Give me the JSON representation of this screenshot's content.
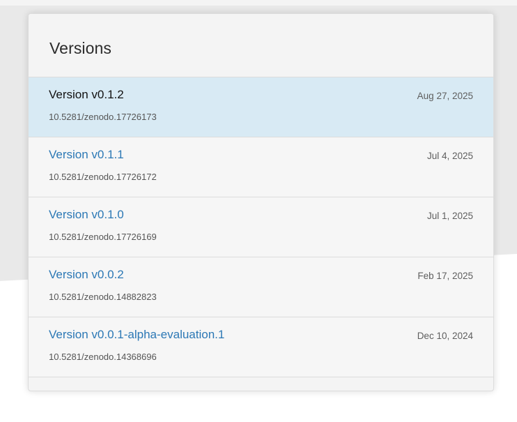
{
  "panel": {
    "title": "Versions"
  },
  "versions": [
    {
      "name": "Version v0.1.2",
      "doi": "10.5281/zenodo.17726173",
      "date": "Aug 27, 2025",
      "selected": true
    },
    {
      "name": "Version v0.1.1",
      "doi": "10.5281/zenodo.17726172",
      "date": "Jul 4, 2025",
      "selected": false
    },
    {
      "name": "Version v0.1.0",
      "doi": "10.5281/zenodo.17726169",
      "date": "Jul 1, 2025",
      "selected": false
    },
    {
      "name": "Version v0.0.2",
      "doi": "10.5281/zenodo.14882823",
      "date": "Feb 17, 2025",
      "selected": false
    },
    {
      "name": "Version v0.0.1-alpha-evaluation.1",
      "doi": "10.5281/zenodo.14368696",
      "date": "Dec 10, 2024",
      "selected": false
    }
  ],
  "colors": {
    "link": "#2c78b5",
    "selected_background": "#d8eaf4"
  }
}
